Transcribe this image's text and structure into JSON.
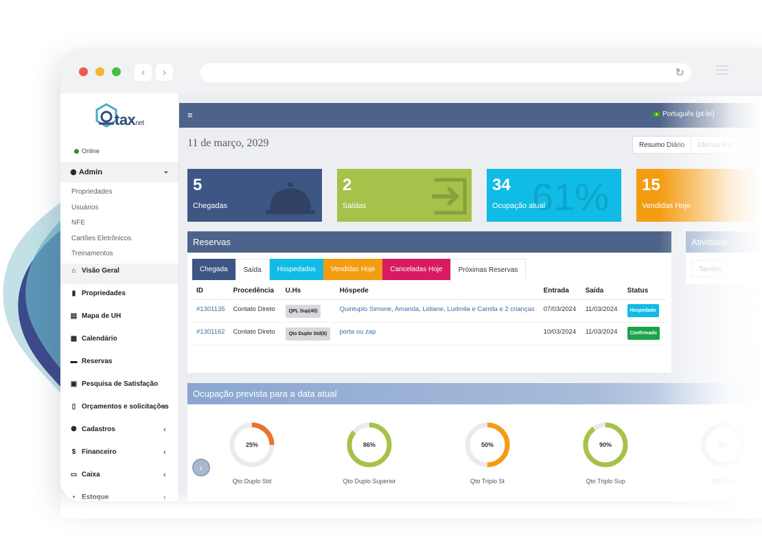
{
  "brand": {
    "logo_text": "tax",
    "logo_sub": "net"
  },
  "status": {
    "label": "Online"
  },
  "sidebar": {
    "admin": {
      "label": "Admin"
    },
    "admin_items": [
      "Propriedades",
      "Usuários",
      "NFE",
      "Cartões Eletrônicos",
      "Treinamentos"
    ],
    "items": [
      {
        "label": "Visão Geral",
        "icon": "home-icon",
        "glyph": "⌂"
      },
      {
        "label": "Propriedades",
        "icon": "building-icon",
        "glyph": "▮"
      },
      {
        "label": "Mapa de UH",
        "icon": "map-icon",
        "glyph": "▤"
      },
      {
        "label": "Calendário",
        "icon": "calendar-icon",
        "glyph": "▦"
      },
      {
        "label": "Reservas",
        "icon": "book-icon",
        "glyph": "▬"
      },
      {
        "label": "Pesquisa de Satisfação",
        "icon": "survey-icon",
        "glyph": "▣"
      },
      {
        "label": "Orçamentos e solicitações",
        "icon": "file-icon",
        "glyph": "▯"
      },
      {
        "label": "Cadastros",
        "icon": "users-icon",
        "glyph": "⚉"
      },
      {
        "label": "Financeiro",
        "icon": "dollar-icon",
        "glyph": "$"
      },
      {
        "label": "Caixa",
        "icon": "cash-icon",
        "glyph": "▭"
      },
      {
        "label": "Estoque",
        "icon": "box-icon",
        "glyph": "▪"
      }
    ]
  },
  "header": {
    "menu_glyph": "≡",
    "language": "Português (pt-br)"
  },
  "date": "11 de março, 2029",
  "view_tabs": [
    "Resumo Diário",
    "Ultimas Re"
  ],
  "stats": [
    {
      "value": "5",
      "label": "Chegadas",
      "color": "#3e5683"
    },
    {
      "value": "2",
      "label": "Saídas",
      "color": "#a6c24a"
    },
    {
      "value": "34",
      "label": "Ocupação atual",
      "color": "#10bce6",
      "bg_text": "61%"
    },
    {
      "value": "15",
      "label": "Vendidas Hoje",
      "color": "#f39c12"
    }
  ],
  "reservas": {
    "title": "Reservas",
    "tabs": [
      {
        "label": "Chegada",
        "color": "#3e5683"
      },
      {
        "label": "Saída",
        "color": ""
      },
      {
        "label": "Hospedados",
        "color": "#10bce6"
      },
      {
        "label": "Vendidas Hoje",
        "color": "#f39c12"
      },
      {
        "label": "Canceladas Hoje",
        "color": "#d81b60"
      },
      {
        "label": "Próximas Reservas",
        "color": ""
      }
    ],
    "columns": [
      "ID",
      "Procedência",
      "U.Hs",
      "Hóspede",
      "Entrada",
      "Saída",
      "Status"
    ],
    "rows": [
      {
        "id": "#1301135",
        "procedencia": "Contato Direto",
        "uh": "QPL Sup(45)",
        "hospede": "Quintuplo Simone, Amanda, Lidiane, Ludmila e Camila e 2 crianças",
        "entrada": "07/03/2024",
        "saida": "11/03/2024",
        "status": "Hospedado",
        "status_color": "#10bce6"
      },
      {
        "id": "#1301162",
        "procedencia": "Contato Direto",
        "uh": "Qto Duplo Std(6)",
        "hospede": "porta ou zap",
        "entrada": "10/03/2024",
        "saida": "11/03/2024",
        "status": "Confirmado",
        "status_color": "#19a34a"
      }
    ]
  },
  "atividade": {
    "title": "Atividade",
    "tab": "Tarefas"
  },
  "ocupacao": {
    "title": "Ocupação prevista para a data atual",
    "items": [
      {
        "pct": 25,
        "label": "25%",
        "name": "Qto Duplo Std",
        "color": "#e8732a"
      },
      {
        "pct": 86,
        "label": "86%",
        "name": "Qto Duplo Superior",
        "color": "#a6c24a"
      },
      {
        "pct": 50,
        "label": "50%",
        "name": "Qto Triplo St",
        "color": "#f39c12"
      },
      {
        "pct": 90,
        "label": "90%",
        "name": "Qto Triplo Sup",
        "color": "#a6c24a"
      },
      {
        "pct": 0,
        "label": "0%",
        "name": "Qto Qua",
        "color": "#cccccc"
      }
    ]
  }
}
